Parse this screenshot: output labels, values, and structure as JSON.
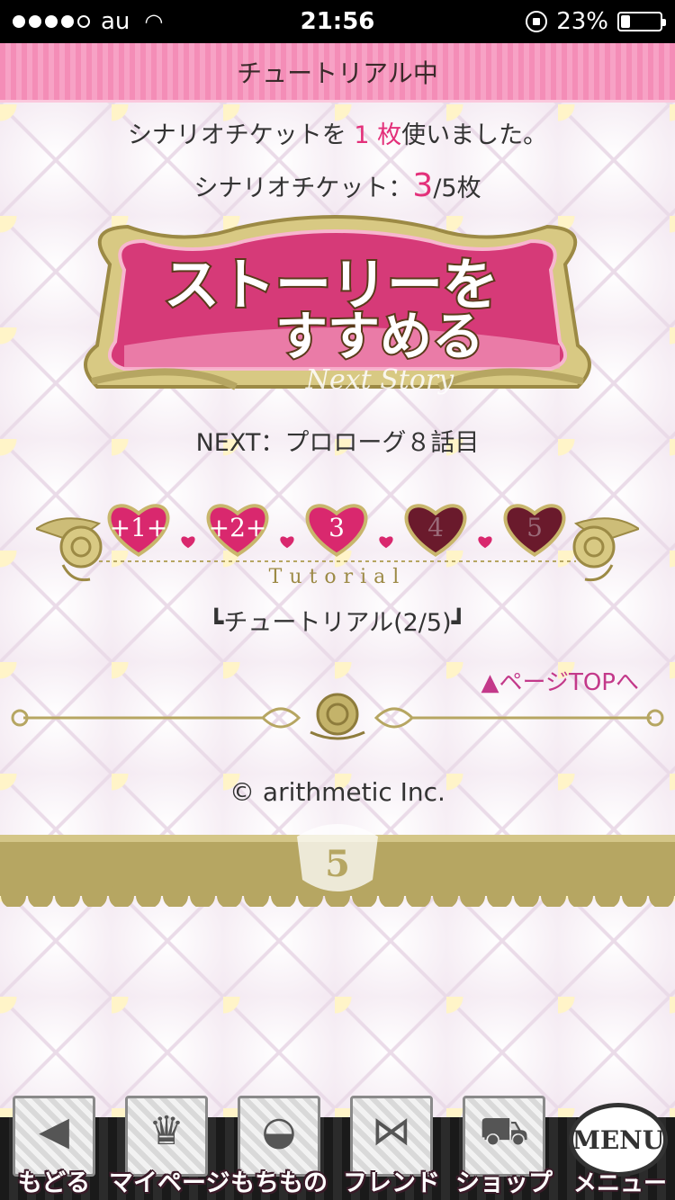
{
  "status_bar": {
    "carrier": "au",
    "time": "21:56",
    "battery": "23%",
    "battery_level": 0.23
  },
  "header": {
    "title": "チュートリアル中"
  },
  "ticket_message": {
    "before": "シナリオチケットを ",
    "count": "1 枚",
    "after": "使いました。"
  },
  "ticket_status": {
    "label": "シナリオチケット：",
    "current": "3",
    "suffix": "/5枚"
  },
  "logo": {
    "title_line1": "ストーリーを",
    "title_line2": "すすめる",
    "subtitle": "Next Story"
  },
  "next_chapter": "NEXT：プロローグ８話目",
  "progress": {
    "hearts": [
      {
        "label": "+1+",
        "completed": true
      },
      {
        "label": "+2+",
        "completed": true
      },
      {
        "label": "3",
        "completed": true
      },
      {
        "label": "4",
        "completed": false
      },
      {
        "label": "5",
        "completed": false
      }
    ],
    "ribbon_text": "Tutorial",
    "caption": "┗チュートリアル(2/5)┛"
  },
  "page_top_link": "▲ページTOPへ",
  "copyright": "© arithmetic Inc.",
  "lace_emblem": "5",
  "bottom_nav": {
    "items": [
      {
        "label": "もどる",
        "icon": "back-arrow-icon"
      },
      {
        "label": "マイページ",
        "icon": "crest-icon"
      },
      {
        "label": "もちもの",
        "icon": "bag-icon"
      },
      {
        "label": "フレンド",
        "icon": "bow-icon"
      },
      {
        "label": "ショップ",
        "icon": "cart-icon"
      }
    ],
    "menu_badge": "MENU",
    "menu_label": "メニュー"
  },
  "colors": {
    "accent_pink": "#e3307a",
    "header_pink": "#f48db7",
    "gold": "#b6a662",
    "heart_active": "#d9286e",
    "heart_inactive": "#6a1a2c"
  }
}
